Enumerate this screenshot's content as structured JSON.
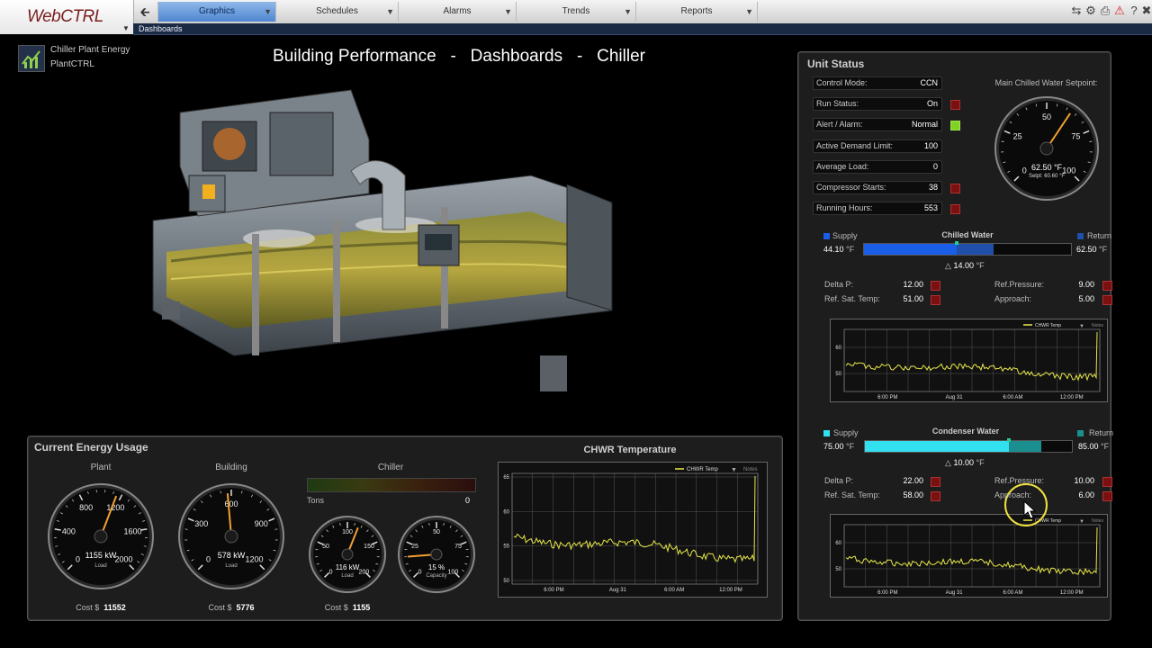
{
  "nav": {
    "logo": "WebCTRL",
    "tabs": [
      "Graphics",
      "Schedules",
      "Alarms",
      "Trends",
      "Reports"
    ],
    "breadcrumb": "Dashboards"
  },
  "header": {
    "app_name_line1": "Chiller Plant Energy",
    "app_name_line2": "PlantCTRL",
    "title": "Building Performance   -   Dashboards   -   Chiller"
  },
  "energy": {
    "title": "Current Energy Usage",
    "plant": {
      "label": "Plant",
      "value": "1155",
      "unit": "kW",
      "sub": "Load",
      "cost_label": "Cost $",
      "cost": "11552",
      "ticks": [
        "0",
        "400",
        "800",
        "1200",
        "1600",
        "2000"
      ]
    },
    "building": {
      "label": "Building",
      "value": "578",
      "unit": "kW",
      "sub": "Load",
      "cost_label": "Cost $",
      "cost": "5776",
      "ticks": [
        "0",
        "300",
        "600",
        "900",
        "1200"
      ]
    },
    "chiller": {
      "label": "Chiller",
      "tons_label": "Tons",
      "tons": "0",
      "load": {
        "value": "116",
        "unit": "kW",
        "sub": "Load",
        "ticks": [
          "0",
          "50",
          "100",
          "150",
          "200"
        ]
      },
      "capacity": {
        "value": "15",
        "unit": "%",
        "sub": "Capacity",
        "ticks": [
          "0",
          "25",
          "50",
          "75",
          "100"
        ]
      },
      "cost_label": "Cost $",
      "cost": "1155"
    }
  },
  "chwr_chart": {
    "title": "CHWR Temperature",
    "legend": "CHWR Temp",
    "notes": "Notes",
    "y_ticks": [
      "65",
      "60",
      "55",
      "50"
    ],
    "x_ticks": [
      "6:00 PM",
      "Aug 31",
      "6:00 AM",
      "12:00 PM"
    ]
  },
  "unit_status": {
    "title": "Unit Status",
    "rows": [
      {
        "label": "Control Mode:",
        "value": "CCN",
        "ind": ""
      },
      {
        "label": "Run Status:",
        "value": "On",
        "ind": "red"
      },
      {
        "label": "Alert / Alarm:",
        "value": "Normal",
        "ind": "green"
      },
      {
        "label": "Active Demand Limit:",
        "value": "100",
        "ind": ""
      },
      {
        "label": "Average Load:",
        "value": "0",
        "ind": ""
      },
      {
        "label": "Compressor Starts:",
        "value": "38",
        "ind": "red"
      },
      {
        "label": "Running Hours:",
        "value": "553",
        "ind": "red"
      }
    ],
    "setpoint": {
      "label": "Main Chilled Water Setpoint:",
      "value": "62.50",
      "unit": "°F",
      "setpt_label": "Setpt:",
      "setpt": "60.60",
      "setpt_unit": "°F",
      "ticks": [
        "0",
        "25",
        "50",
        "75",
        "100"
      ]
    }
  },
  "chilled_water": {
    "title": "Chilled Water",
    "supply_label": "Supply",
    "return_label": "Return",
    "supply": "44.10",
    "return": "62.50",
    "unit": "°F",
    "delta": "14.00",
    "delta_unit": "°F",
    "delta_p_label": "Delta P:",
    "delta_p": "12.00",
    "ref_pressure_label": "Ref.Pressure:",
    "ref_pressure": "9.00",
    "ref_sat_label": "Ref. Sat. Temp:",
    "ref_sat": "51.00",
    "approach_label": "Approach:",
    "approach": "5.00",
    "chart": {
      "legend": "CHWR Temp",
      "notes": "Notes",
      "y_ticks": [
        "60",
        "50"
      ],
      "x_ticks": [
        "6:00 PM",
        "Aug 31",
        "6:00 AM",
        "12:00 PM"
      ]
    }
  },
  "condenser_water": {
    "title": "Condenser Water",
    "supply_label": "Supply",
    "return_label": "Return",
    "supply": "75.00",
    "return": "85.00",
    "unit": "°F",
    "delta": "10.00",
    "delta_unit": "°F",
    "delta_p_label": "Delta P:",
    "delta_p": "22.00",
    "ref_pressure_label": "Ref.Pressure:",
    "ref_pressure": "10.00",
    "ref_sat_label": "Ref. Sat. Temp:",
    "ref_sat": "58.00",
    "approach_label": "Approach:",
    "approach": "6.00",
    "chart": {
      "legend": "CHWR Temp",
      "notes": "Notes",
      "y_ticks": [
        "60",
        "50"
      ],
      "x_ticks": [
        "6:00 PM",
        "Aug 31",
        "6:00 AM",
        "12:00 PM"
      ]
    }
  },
  "colors": {
    "accent": "#4f86d1",
    "chilled_bar": "#1a5ee8",
    "condenser_bar": "#33e0f0",
    "trend_line": "#e8e84a",
    "needle": "#f0a030"
  }
}
